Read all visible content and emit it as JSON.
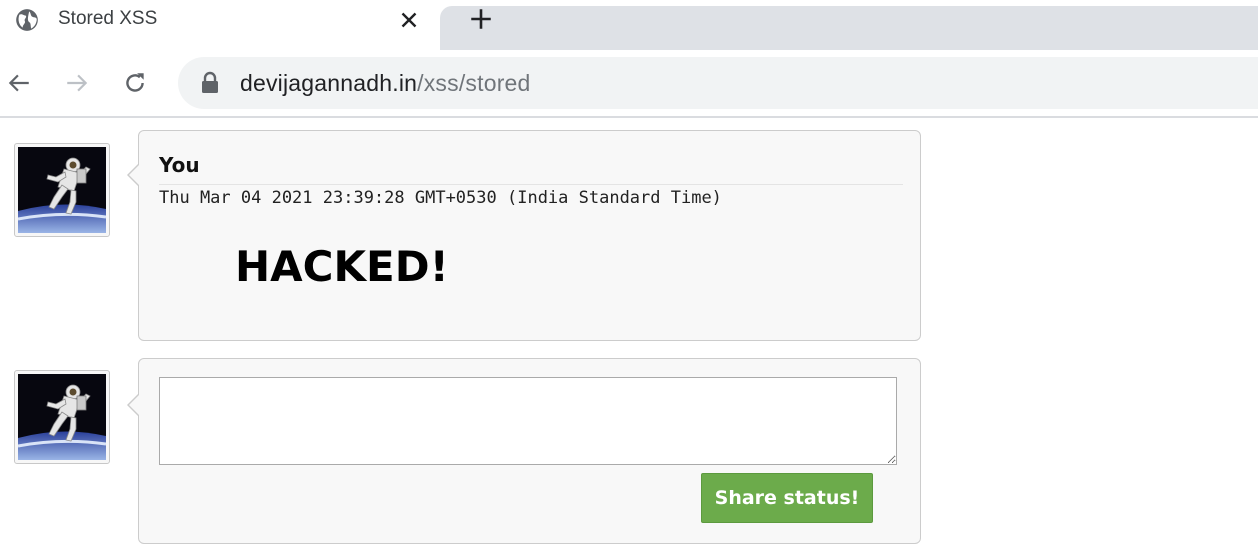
{
  "browser": {
    "tab": {
      "title": "Stored XSS",
      "icon": "globe-icon"
    },
    "address_bar": {
      "host": "devijagannadh.in",
      "path": "/xss/stored"
    }
  },
  "posts": [
    {
      "author": "You",
      "timestamp": "Thu Mar 04 2021 23:39:28 GMT+0530 (India Standard Time)",
      "message": "HACKED!"
    }
  ],
  "composer": {
    "value": "",
    "placeholder": "",
    "button_label": "Share status!"
  },
  "colors": {
    "button_bg": "#6cab4b",
    "card_bg": "#f8f8f8",
    "tab_strip": "#dee1e6"
  }
}
